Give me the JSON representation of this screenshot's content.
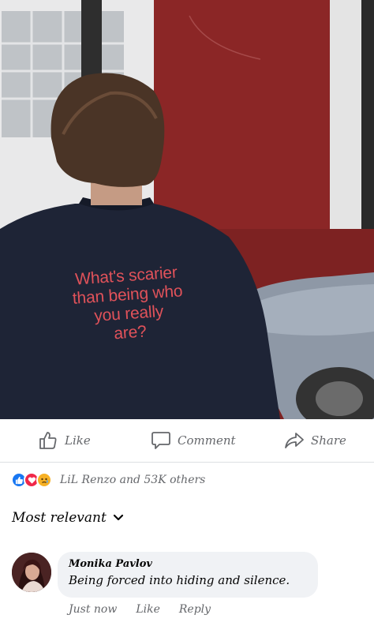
{
  "post": {
    "shirt_text_lines": [
      "What's scarier",
      "than being who",
      "you really",
      "are?"
    ]
  },
  "actions": {
    "like_label": "Like",
    "comment_label": "Comment",
    "share_label": "Share"
  },
  "reactions": {
    "icons": [
      "like-icon",
      "love-icon",
      "sad-icon"
    ],
    "summary": "LiL Renzo and 53K others"
  },
  "sort": {
    "label": "Most relevant"
  },
  "comment": {
    "author": "Monika Pavlov",
    "text": "Being forced into hiding and silence.",
    "time": "Just now",
    "like_label": "Like",
    "reply_label": "Reply"
  },
  "colors": {
    "facebook_blue": "#1877f2",
    "secondary_text": "#65676b",
    "bubble_bg": "#f0f2f5",
    "shirt_text": "#e0525a"
  }
}
